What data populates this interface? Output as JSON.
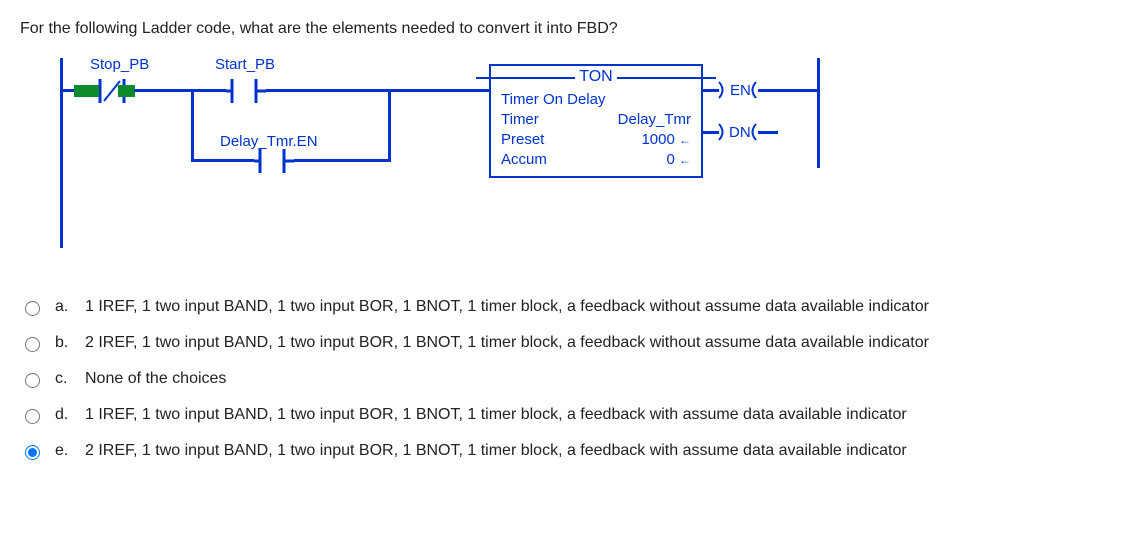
{
  "question": "For the following Ladder code, what are the elements needed to convert it into FBD?",
  "ladder": {
    "stop_pb": "Stop_PB",
    "start_pb": "Start_PB",
    "delay_tmr_en": "Delay_Tmr.EN",
    "ton": "TON",
    "timer_on_delay": "Timer On Delay",
    "timer_label": "Timer",
    "timer_value": "Delay_Tmr",
    "preset_label": "Preset",
    "preset_value": "1000",
    "accum_label": "Accum",
    "accum_value": "0",
    "en": "EN",
    "dn": "DN"
  },
  "options": [
    {
      "letter": "a.",
      "text": "1 IREF, 1 two input BAND, 1 two input BOR, 1 BNOT, 1 timer block, a feedback without assume data available indicator",
      "selected": false
    },
    {
      "letter": "b.",
      "text": "2 IREF, 1 two input BAND, 1 two input BOR, 1 BNOT, 1 timer block, a feedback without assume data available indicator",
      "selected": false
    },
    {
      "letter": "c.",
      "text": "None of the choices",
      "selected": false
    },
    {
      "letter": "d.",
      "text": "1 IREF, 1 two input BAND, 1 two input BOR, 1 BNOT, 1 timer block, a feedback with assume data available indicator",
      "selected": false
    },
    {
      "letter": "e.",
      "text": "2 IREF, 1 two input BAND, 1 two input BOR, 1 BNOT, 1 timer block, a feedback with assume data available indicator",
      "selected": true
    }
  ]
}
